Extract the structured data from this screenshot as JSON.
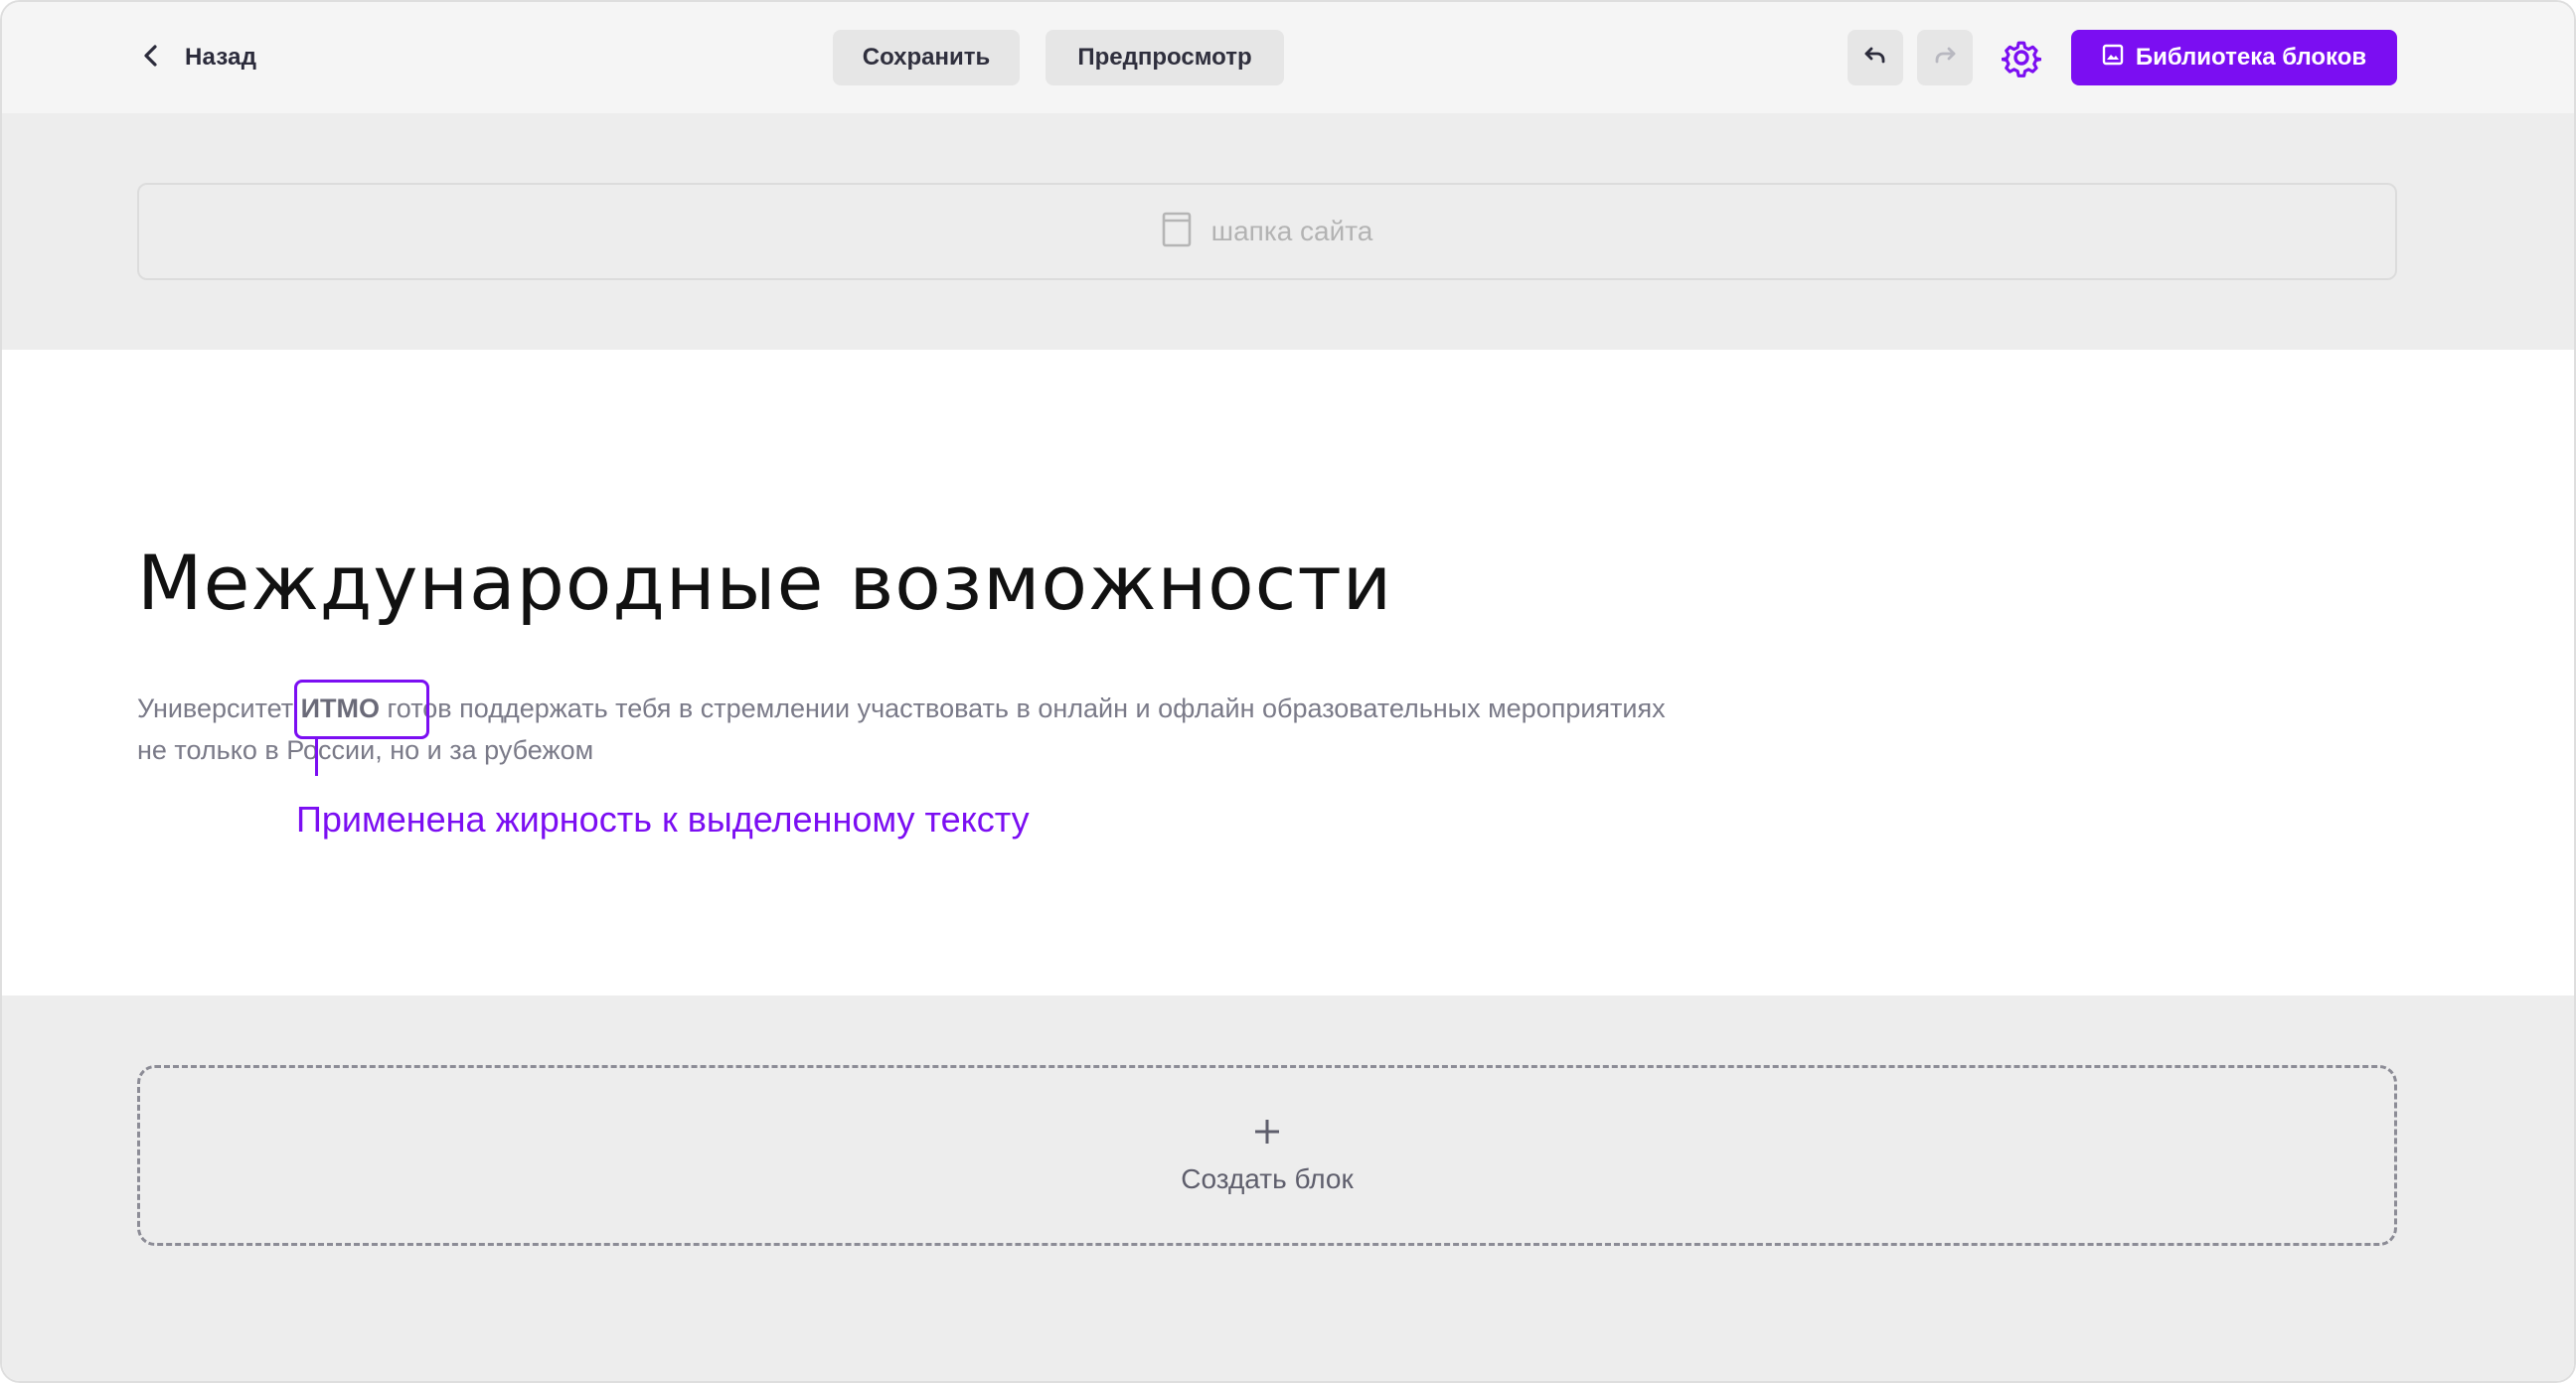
{
  "toolbar": {
    "back_label": "Назад",
    "save_label": "Сохранить",
    "preview_label": "Предпросмотр",
    "library_label": "Библиотека блоков",
    "accent_color": "#7b0ef2",
    "icons": [
      "chevron-left-icon",
      "undo-icon",
      "redo-icon",
      "gear-icon",
      "image-icon"
    ]
  },
  "header_block": {
    "label": "шапка сайта",
    "icon": "page-icon"
  },
  "content": {
    "title": "Международные возможности",
    "paragraph": {
      "before": "Университет ",
      "bold": "ИТМО",
      "after": " готов поддержать тебя в стремлении участвовать в онлайн и офлайн образовательных мероприятиях не только в России, но и за рубежом"
    },
    "annotation": "Применена жирность к выделенному тексту"
  },
  "create_block": {
    "label": "Создать блок",
    "icon": "plus-icon"
  }
}
